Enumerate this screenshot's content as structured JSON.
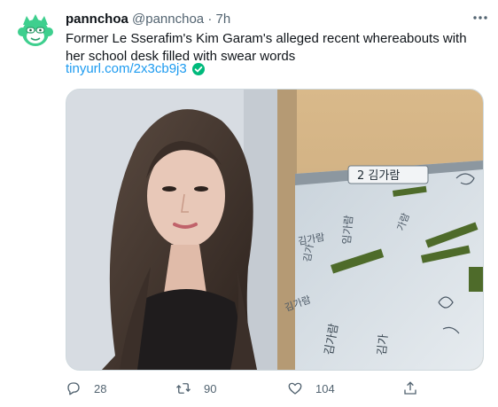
{
  "tweet": {
    "display_name": "pannchoa",
    "handle": "@pannchoa",
    "separator": "·",
    "time": "7h",
    "text": "Former Le Sserafim's Kim Garam's alleged recent whereabouts with her school desk filled with swear words",
    "link": "tinyurl.com/2x3cb9j3",
    "desk_label": "2 김가람",
    "desk_scribbles": [
      "김가람",
      "김가",
      "임가람",
      "가람",
      "김가람",
      "김가람",
      "김가"
    ]
  },
  "actions": {
    "reply_count": "28",
    "retweet_count": "90",
    "like_count": "104"
  },
  "colors": {
    "brand_green": "#3ecf8e",
    "link_blue": "#1d9bf0",
    "muted": "#536471",
    "verified_green": "#00ba7c"
  },
  "icons": [
    "monkey-avatar-icon",
    "more-dots-icon",
    "verified-check-icon",
    "reply-icon",
    "retweet-icon",
    "like-icon",
    "share-icon"
  ]
}
